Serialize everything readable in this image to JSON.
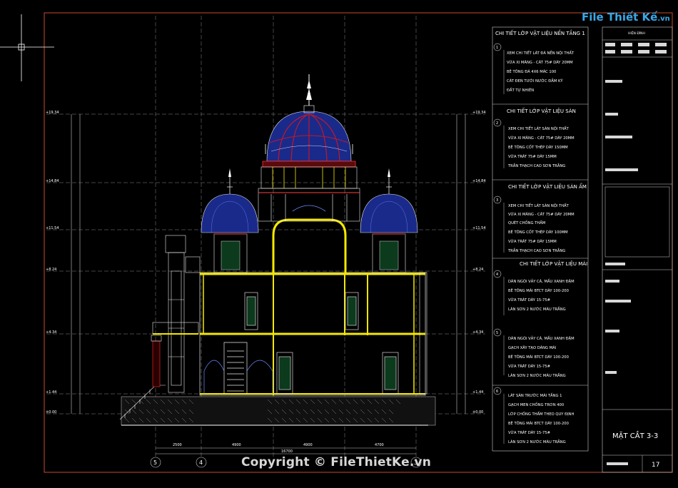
{
  "watermark": "Copyright © FileThietKe.vn",
  "logo": {
    "main": "File Thiết Kế",
    "sub": ".vn"
  },
  "title_block": {
    "sheet_title": "MẶT CẮT 3-3",
    "sheet_number": "17",
    "header_small": "HIỆN ĐÌNH"
  },
  "legend": [
    {
      "number": "1",
      "title": "CHI TIẾT LỚP VẬT LIỆU NỀN TẦNG 1",
      "items": [
        "XEM CHI TIẾT LÁT ĐÁ NỀN NỘI THẤT",
        "VỮA XI MĂNG - CÁT 75# DÀY 20MM",
        "BÊ TÔNG ĐÁ 4X6 MÁC 100",
        "CÁT ĐEN TƯỚI NƯỚC ĐẦM KỸ",
        "ĐẤT TỰ NHIÊN"
      ]
    },
    {
      "number": "2",
      "title": "CHI TIẾT LỚP VẬT LIỆU SÀN",
      "items": [
        "XEM CHI TIẾT LÁT SÀN NỘI THẤT",
        "VỮA XI MĂNG - CÁT 75# DÀY 20MM",
        "BÊ TÔNG CỐT THÉP DÀY 150MM",
        "VỮA TRÁT 75# DÀY 15MM",
        "TRẦN THẠCH CAO SƠN TRẮNG"
      ]
    },
    {
      "number": "3",
      "title": "CHI TIẾT LỚP VẬT LIỆU SÀN ẨM",
      "items": [
        "XEM CHI TIẾT LÁT SÀN NỘI THẤT",
        "VỮA XI MĂNG - CÁT 75# DÀY 20MM",
        "QUÉT CHỐNG THẤM",
        "BÊ TÔNG CỐT THÉP DÀY 100MM",
        "VỮA TRÁT 75# DÀY 15MM",
        "TRẦN THẠCH CAO SƠN TRẮNG"
      ]
    },
    {
      "number": "4",
      "title": "CHI TIẾT LỚP VẬT LIỆU MÁI",
      "items": [
        "DÁN NGÓI VẢY CÁ, MẦU XANH ĐẬM",
        "BÊ TÔNG MÁI BTCT DÀY 100-200",
        "VỮA TRÁT DÀY 15-75#",
        "LÀN SƠN 2 NƯỚC MÀU TRẮNG"
      ]
    },
    {
      "number": "5",
      "title": "",
      "items": [
        "DÁN NGÓI VẢY CÁ, MẦU XANH ĐẬM",
        "GẠCH XÂY TẠO DÁNG MÁI",
        "BÊ TÔNG MÁI BTCT DÀY 100-200",
        "VỮA TRÁT DÀY 15-75#",
        "LÀN SƠN 2 NƯỚC MÀU TRẮNG"
      ]
    },
    {
      "number": "6",
      "title": "",
      "items": [
        "LÁT SÀN TRƯỚC MÁI TẦNG 1",
        "GẠCH MEN CHỐNG TRƠN 400",
        "LỚP CHỐNG THẤM THEO QUY ĐỊNH",
        "BÊ TÔNG MÁI BTCT DÀY 100-200",
        "VỮA TRÁT DÀY 15-75#",
        "LÀN SƠN 2 NƯỚC MÀU TRẮNG"
      ]
    }
  ],
  "level_marks_left": [
    "+19.34",
    "+14.84",
    "+11.54",
    "+8.24",
    "+4.34",
    "+1.44",
    "±0.00"
  ],
  "level_marks_right": [
    "+19.34",
    "+14.84",
    "+11.54",
    "+8.24",
    "+4.34",
    "+1.44",
    "±0.00"
  ],
  "axis_labels": [
    "5",
    "4",
    "3"
  ],
  "dim_bottom": [
    "2500",
    "4900",
    "4900",
    "4700"
  ],
  "dim_total": "16700",
  "colors": {
    "background": "#000000",
    "frame": "#c84a2a",
    "grid": "#9a9a9a",
    "slab": "#f5e800",
    "dome_blue": "#1a2a8a",
    "dome_red": "#c0182a",
    "ground_hatch": "#b0b0b0"
  }
}
